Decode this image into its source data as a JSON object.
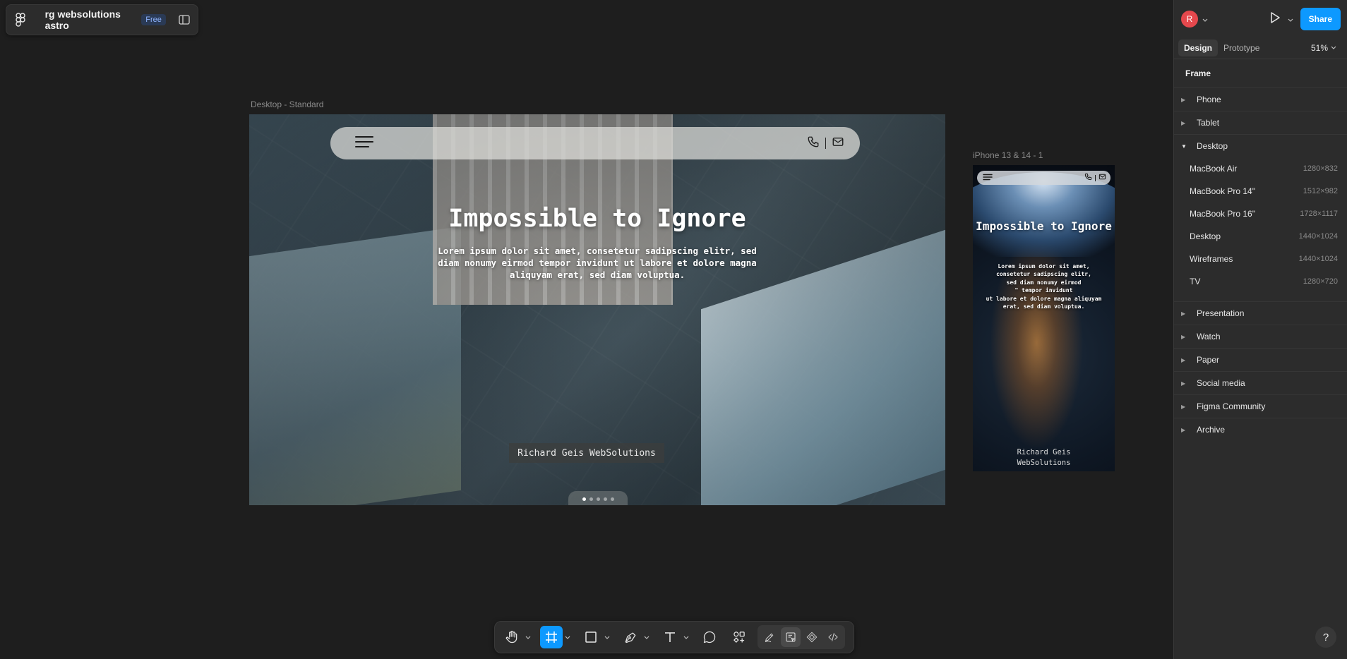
{
  "file": {
    "name": "rg websolutions astro",
    "plan_badge": "Free"
  },
  "canvas": {
    "desktop_frame_label": "Desktop - Standard",
    "phone_frame_label": "iPhone 13 & 14 - 1",
    "desktop": {
      "title": "Impossible to Ignore",
      "subtitle": "Lorem ipsum dolor sit amet, consetetur sadipscing elitr, sed diam nonumy eirmod tempor invidunt ut labore et dolore magna aliquyam erat, sed diam voluptua.",
      "brand": "Richard Geis WebSolutions",
      "slides": 5,
      "active_slide": 1
    },
    "phone": {
      "title": "Impossible to Ignore",
      "subtitle": "Lorem ipsum dolor sit amet,\nconsetetur sadipscing elitr,\nsed diam nonumy eirmod\n\" tempor invidunt\nut labore et dolore magna aliquyam\nerat, sed diam voluptua.",
      "brand": "Richard Geis\nWebSolutions"
    }
  },
  "toolbar": {
    "tools": [
      "hand-icon",
      "frame-icon",
      "rectangle-icon",
      "pen-icon",
      "text-icon",
      "comment-icon",
      "actions-icon"
    ],
    "active_tool": "frame-icon",
    "dev_tools": [
      "draw-icon",
      "design-mode-icon",
      "component-icon",
      "dev-mode-icon"
    ]
  },
  "right_panel": {
    "avatar_initial": "R",
    "share_label": "Share",
    "tabs": {
      "design": "Design",
      "prototype": "Prototype"
    },
    "zoom": "51%",
    "section_title": "Frame",
    "categories_top": [
      {
        "label": "Phone",
        "expanded": false
      },
      {
        "label": "Tablet",
        "expanded": false
      },
      {
        "label": "Desktop",
        "expanded": true
      }
    ],
    "desktop_presets": [
      {
        "name": "MacBook Air",
        "dims": "1280×832"
      },
      {
        "name": "MacBook Pro 14\"",
        "dims": "1512×982"
      },
      {
        "name": "MacBook Pro 16\"",
        "dims": "1728×1117"
      },
      {
        "name": "Desktop",
        "dims": "1440×1024"
      },
      {
        "name": "Wireframes",
        "dims": "1440×1024"
      },
      {
        "name": "TV",
        "dims": "1280×720"
      }
    ],
    "categories_bottom": [
      {
        "label": "Presentation"
      },
      {
        "label": "Watch"
      },
      {
        "label": "Paper"
      },
      {
        "label": "Social media"
      },
      {
        "label": "Figma Community"
      },
      {
        "label": "Archive"
      }
    ],
    "help_label": "?"
  },
  "colors": {
    "accent": "#0d99ff",
    "canvas": "#1e1e1e",
    "panel": "#2c2c2c",
    "avatar": "#e5484d"
  }
}
